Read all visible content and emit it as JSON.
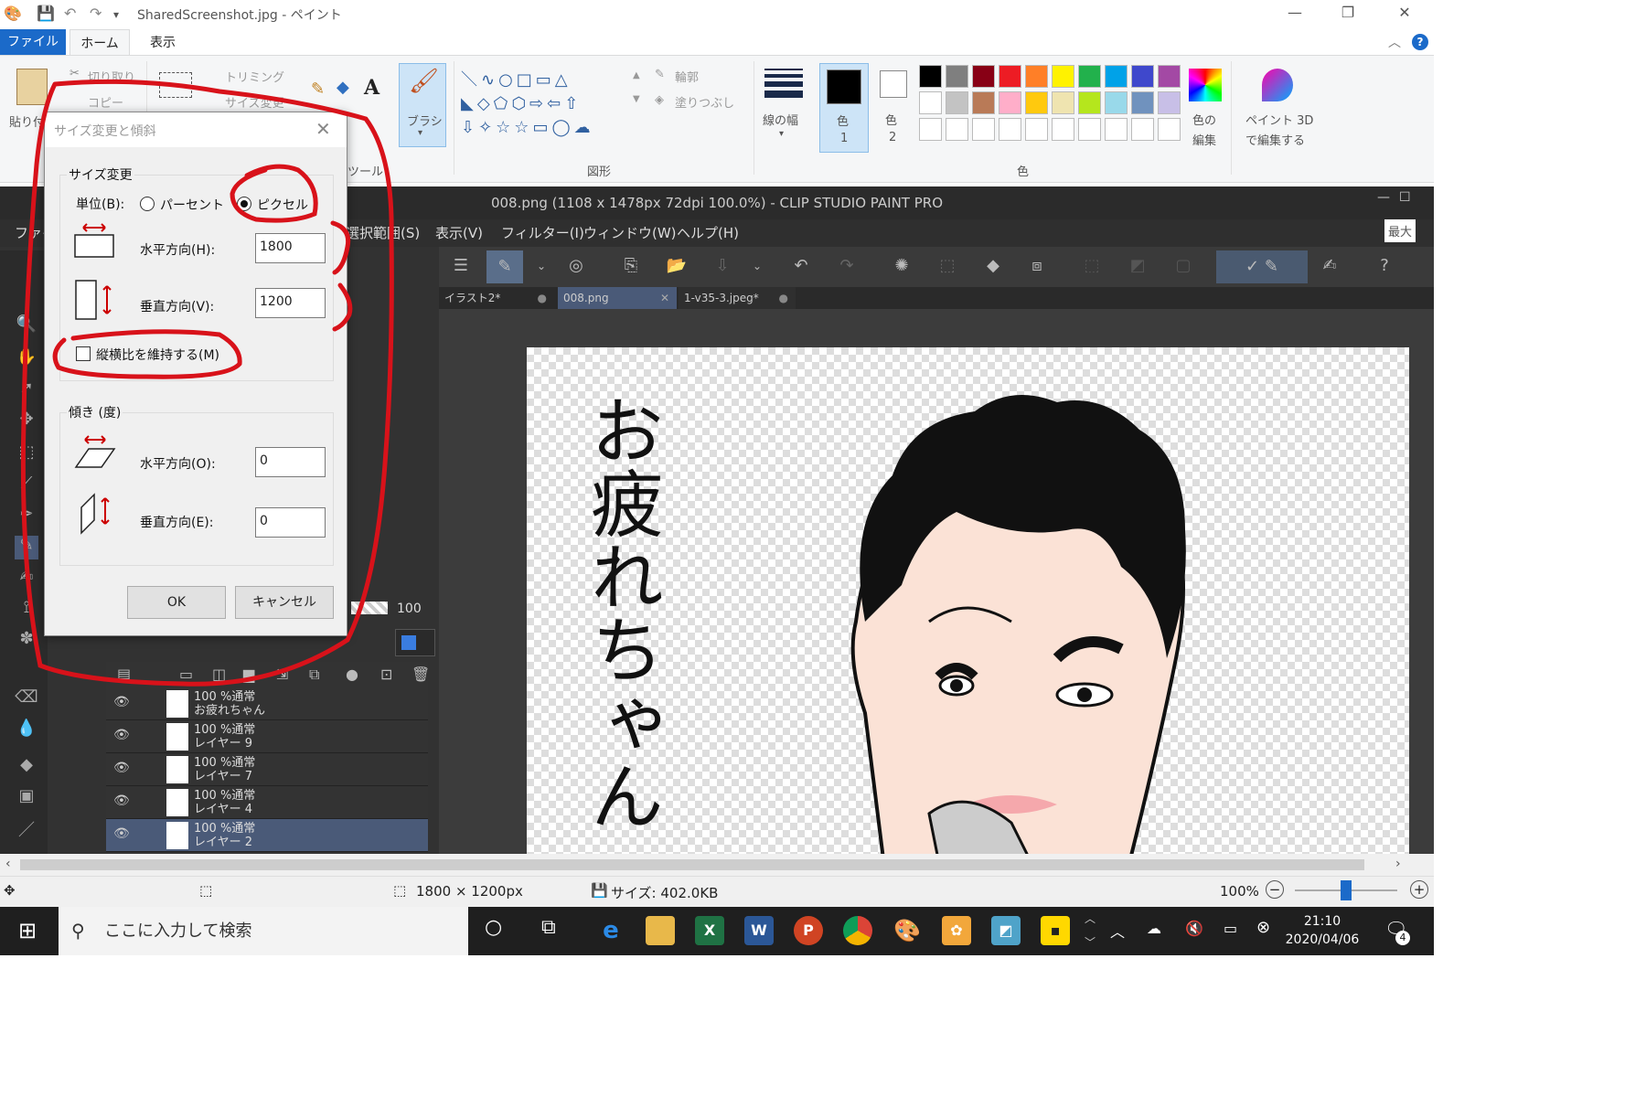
{
  "paint": {
    "window_title": "SharedScreenshot.jpg - ペイント",
    "tabs": {
      "file": "ファイル",
      "home": "ホーム",
      "view": "表示"
    },
    "clipboard": {
      "paste": "貼り付け",
      "cut": "切り取り",
      "copy": "コピー"
    },
    "image": {
      "trim": "トリミング",
      "resize": "サイズ変更"
    },
    "tools_label": "ツール",
    "brush": "ブラシ",
    "shapes": {
      "outline": "輪郭",
      "fill": "塗りつぶし",
      "group_label": "図形"
    },
    "line_width": "線の幅",
    "color1": {
      "label": "色",
      "num": "1"
    },
    "color2": {
      "label": "色",
      "num": "2"
    },
    "edit_colors": [
      "色の",
      "編集"
    ],
    "paint3d": [
      "ペイント 3D",
      "で編集する"
    ],
    "colors_group_label": "色",
    "palette_row1": [
      "#000000",
      "#7f7f7f",
      "#880015",
      "#ed1c24",
      "#ff7f27",
      "#fff200",
      "#22b14c",
      "#00a2e8",
      "#3f48cc",
      "#a349a4"
    ],
    "palette_row2": [
      "#ffffff",
      "#c3c3c3",
      "#b97a57",
      "#ffaec9",
      "#ffc90e",
      "#efe4b0",
      "#b5e61d",
      "#99d9ea",
      "#7092be",
      "#c8bfe7"
    ]
  },
  "csp": {
    "title": "008.png (1108 x 1478px 72dpi 100.0%)  - CLIP STUDIO PAINT PRO",
    "menu": [
      "ファイ",
      "選択範囲(S)",
      "表示(V)",
      "フィルター(I)",
      "ウィンドウ(W)",
      "ヘルプ(H)"
    ],
    "max_label": "最大",
    "doc_tabs": [
      "イラスト2*",
      "008.png",
      "1-v35-3.jpeg*"
    ],
    "canvas_text": "お疲れちゃん",
    "opacity_value": "100",
    "layers": [
      {
        "line1": "100 %通常",
        "line2": "お疲れちゃん"
      },
      {
        "line1": "100 %通常",
        "line2": "レイヤー 9"
      },
      {
        "line1": "100 %通常",
        "line2": "レイヤー 7"
      },
      {
        "line1": "100 %通常",
        "line2": "レイヤー 4"
      },
      {
        "line1": "100 %通常",
        "line2": "レイヤー 2"
      }
    ]
  },
  "dialog": {
    "title": "サイズ変更と傾斜",
    "resize_group": "サイズ変更",
    "unit_label": "単位(B):",
    "unit_percent": "パーセント",
    "unit_pixel": "ピクセル",
    "unit_selected": "pixel",
    "h_label": "水平方向(H):",
    "h_value": "1800",
    "v_label": "垂直方向(V):",
    "v_value": "1200",
    "keep_ratio": "縦横比を維持する(M)",
    "keep_ratio_checked": false,
    "skew_group": "傾き (度)",
    "skew_h_label": "水平方向(O):",
    "skew_h_value": "0",
    "skew_v_label": "垂直方向(E):",
    "skew_v_value": "0",
    "ok": "OK",
    "cancel": "キャンセル"
  },
  "statusbar": {
    "dimensions": "1800 × 1200px",
    "size": "サイズ: 402.0KB",
    "zoom": "100%"
  },
  "taskbar": {
    "search_placeholder": "ここに入力して検索",
    "time": "21:10",
    "date": "2020/04/06",
    "notifications": "4"
  },
  "annotation_color": "#d8121a"
}
